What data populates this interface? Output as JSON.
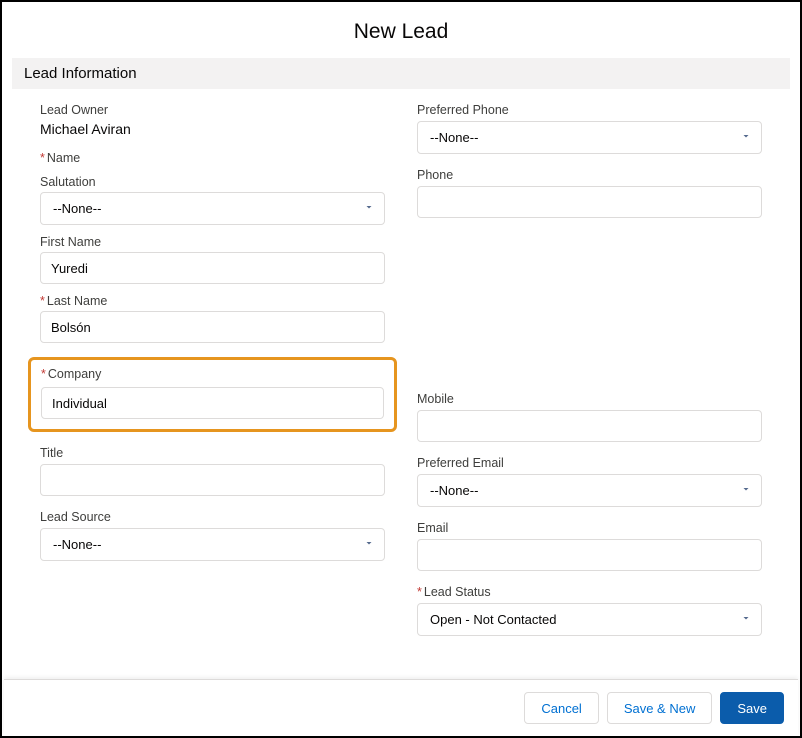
{
  "modal": {
    "title": "New Lead",
    "section_title": "Lead Information"
  },
  "left": {
    "owner_label": "Lead Owner",
    "owner_value": "Michael Aviran",
    "name_label": "Name",
    "salutation_label": "Salutation",
    "salutation_value": "--None--",
    "first_name_label": "First Name",
    "first_name_value": "Yuredi",
    "last_name_label": "Last Name",
    "last_name_value": "Bolsón",
    "company_label": "Company",
    "company_value": "Individual",
    "title_label": "Title",
    "title_value": "",
    "lead_source_label": "Lead Source",
    "lead_source_value": "--None--"
  },
  "right": {
    "preferred_phone_label": "Preferred Phone",
    "preferred_phone_value": "--None--",
    "phone_label": "Phone",
    "phone_value": "",
    "mobile_label": "Mobile",
    "mobile_value": "",
    "preferred_email_label": "Preferred Email",
    "preferred_email_value": "--None--",
    "email_label": "Email",
    "email_value": "",
    "lead_status_label": "Lead Status",
    "lead_status_value": "Open - Not Contacted"
  },
  "footer": {
    "cancel": "Cancel",
    "save_new": "Save & New",
    "save": "Save"
  }
}
